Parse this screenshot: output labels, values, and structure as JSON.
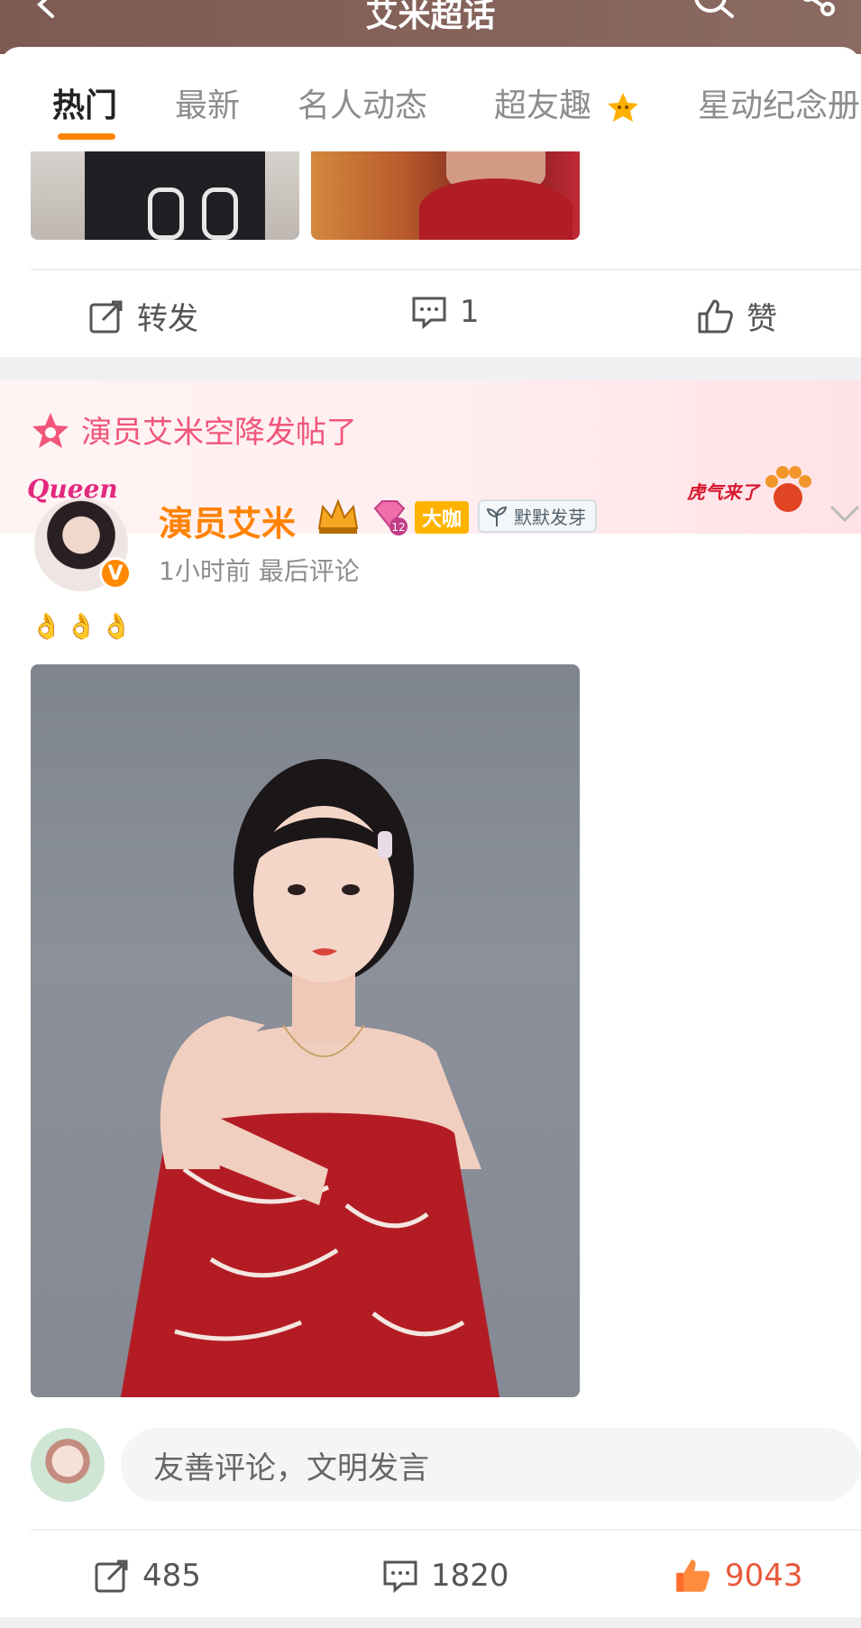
{
  "header": {
    "title": "艾米超话"
  },
  "tabs": [
    {
      "label": "热门"
    },
    {
      "label": "最新"
    },
    {
      "label": "名人动态"
    },
    {
      "label": "超友趣"
    },
    {
      "label": "星动纪念册"
    }
  ],
  "prev_post": {
    "repost_label": "转发",
    "comment_count": "1",
    "like_label": "赞"
  },
  "promo": {
    "text": "演员艾米空降发帖了"
  },
  "post": {
    "frame_text": "Queen",
    "author": "演员艾米",
    "verified_mark": "V",
    "badge_gem_level": "12",
    "badge_daka": "大咖",
    "badge_sprout": "默默发芽",
    "meta": "1小时前 最后评论",
    "content_emoji": "👌👌👌",
    "stats": {
      "reposts": "485",
      "comments": "1820",
      "likes": "9043"
    }
  },
  "comment_input": {
    "placeholder": "友善评论，文明发言"
  },
  "tiger_sticker": "虎气来了",
  "colors": {
    "accent": "#ff8200",
    "promo_pink": "#f0567a",
    "like_active": "#ff6b2b"
  }
}
